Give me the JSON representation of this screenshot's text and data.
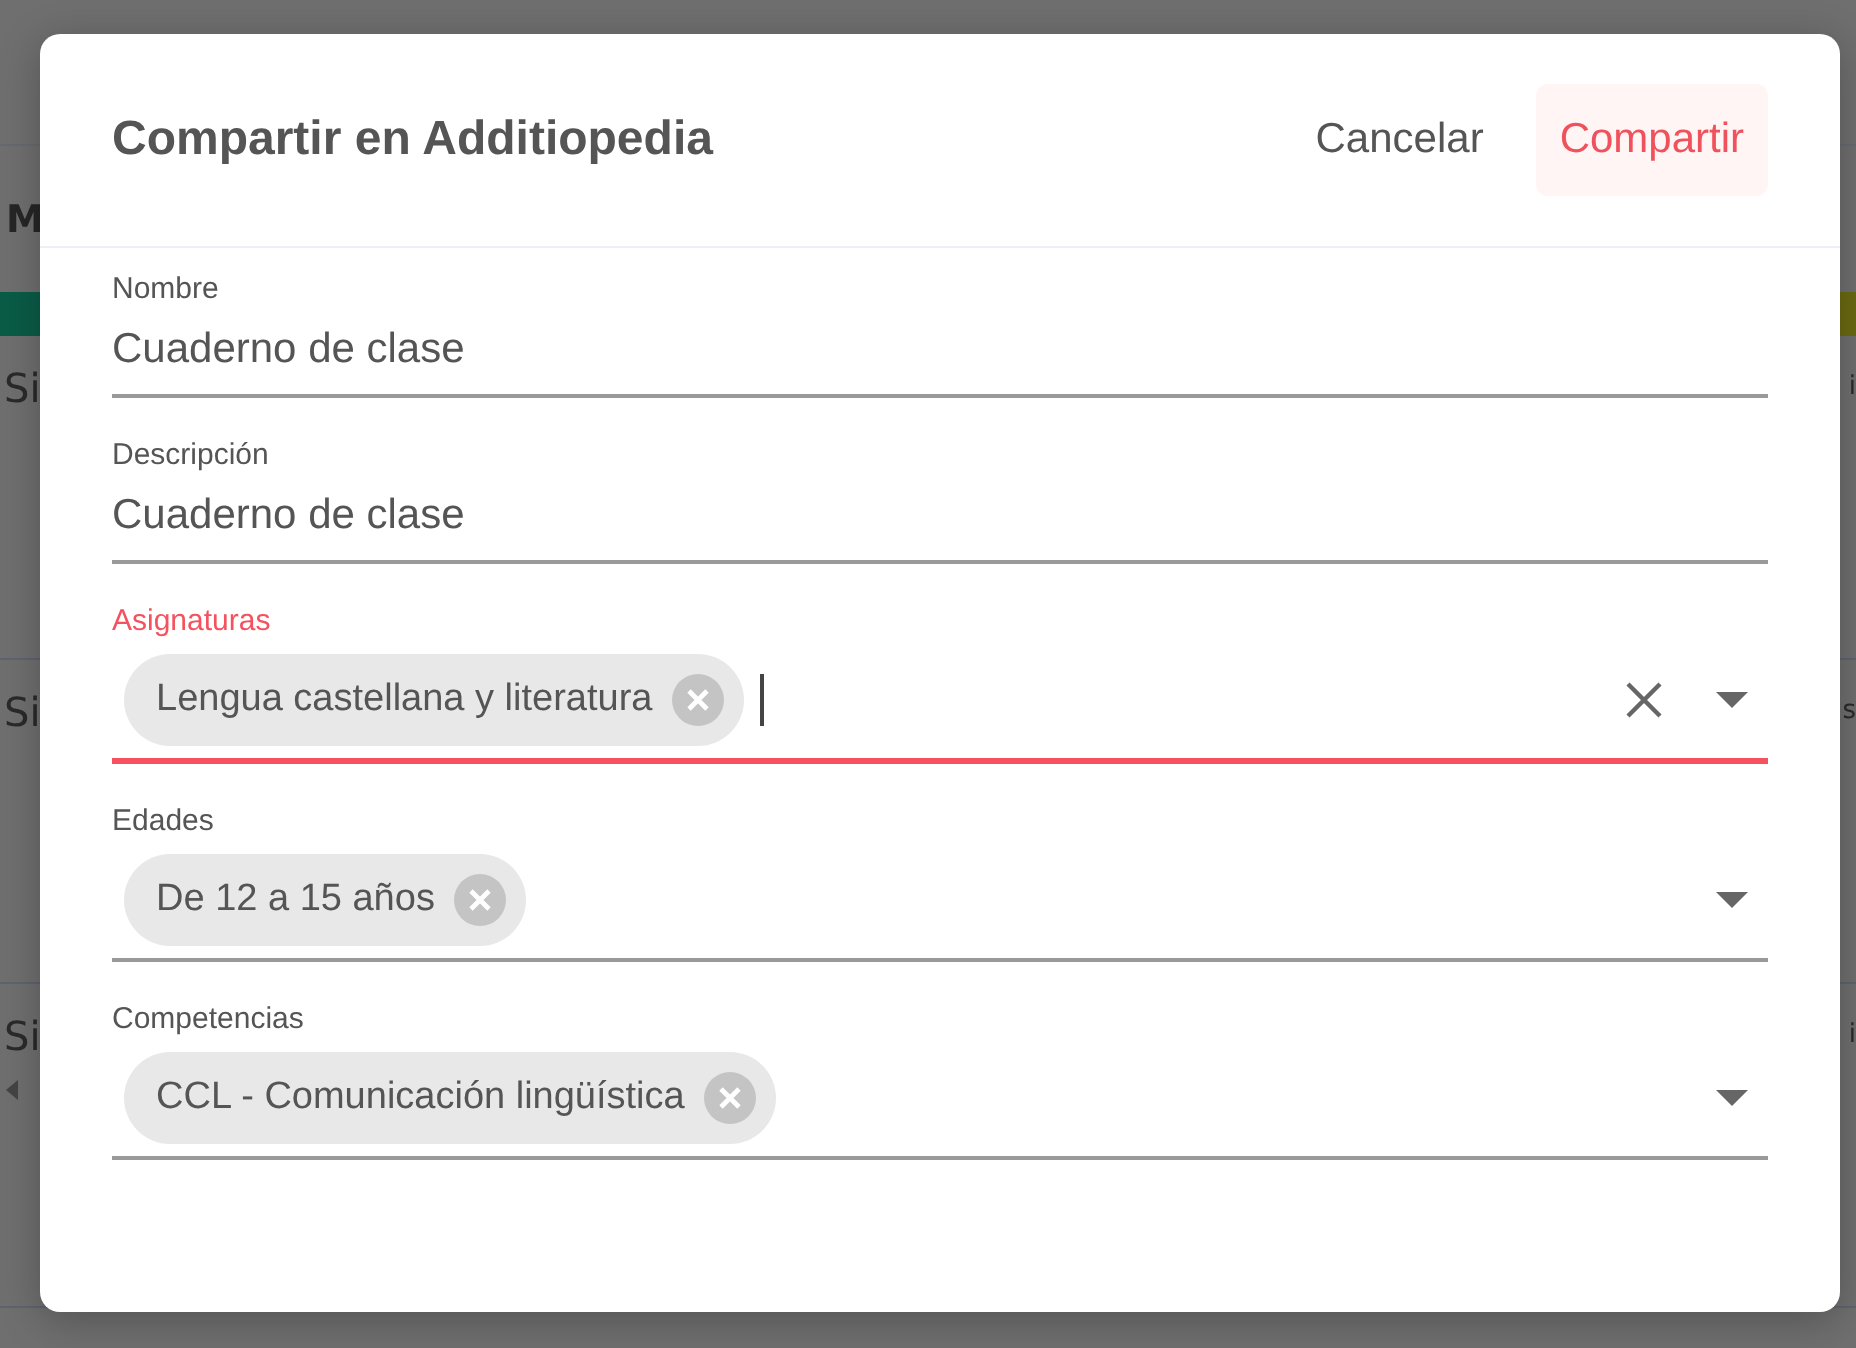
{
  "background": {
    "heading": "M",
    "rows": [
      {
        "left": "Si",
        "right": "i"
      },
      {
        "left": "Si",
        "right": "s"
      },
      {
        "left": "Si",
        "right": "i"
      }
    ]
  },
  "dialog": {
    "title": "Compartir en Additiopedia",
    "cancel": "Cancelar",
    "submit": "Compartir",
    "fields": [
      {
        "kind": "text",
        "label": "Nombre",
        "value": "Cuaderno de clase",
        "focused": false
      },
      {
        "kind": "text",
        "label": "Descripción",
        "value": "Cuaderno de clase",
        "focused": false
      },
      {
        "kind": "select",
        "label": "Asignaturas",
        "chips": [
          "Lengua castellana y literatura"
        ],
        "focused": true,
        "clearable": true
      },
      {
        "kind": "select",
        "label": "Edades",
        "chips": [
          "De 12 a 15 años"
        ],
        "focused": false,
        "clearable": false
      },
      {
        "kind": "select",
        "label": "Competencias",
        "chips": [
          "CCL - Comunicación lingüística"
        ],
        "focused": false,
        "clearable": false
      }
    ]
  }
}
